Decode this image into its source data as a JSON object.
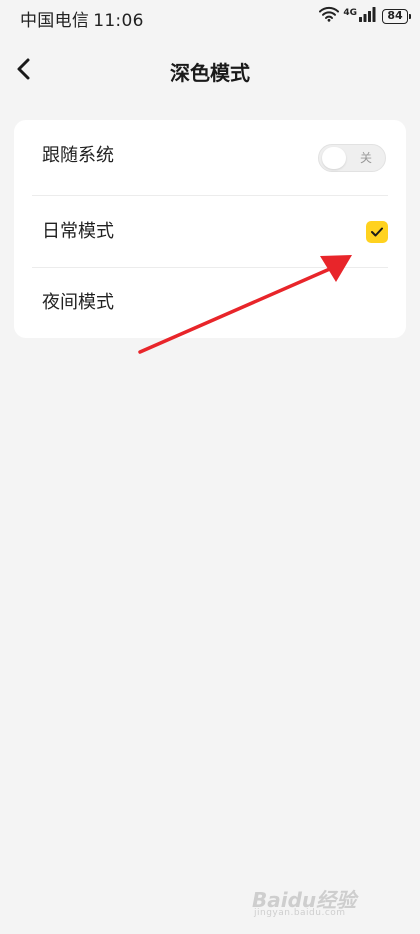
{
  "status_bar": {
    "carrier": "中国电信",
    "time": "11:06",
    "network": "4G",
    "battery": "84"
  },
  "header": {
    "title": "深色模式"
  },
  "settings": {
    "follow_system": {
      "label": "跟随系统",
      "toggle_text": "关",
      "on": false
    },
    "day_mode": {
      "label": "日常模式",
      "selected": true
    },
    "night_mode": {
      "label": "夜间模式",
      "selected": false
    }
  },
  "colors": {
    "accent": "#ffd21f",
    "annotation_arrow": "#e8252a",
    "background": "#f4f4f4",
    "card": "#ffffff"
  },
  "watermark": {
    "brand": "Baidu经验",
    "url": "jingyan.baidu.com"
  }
}
